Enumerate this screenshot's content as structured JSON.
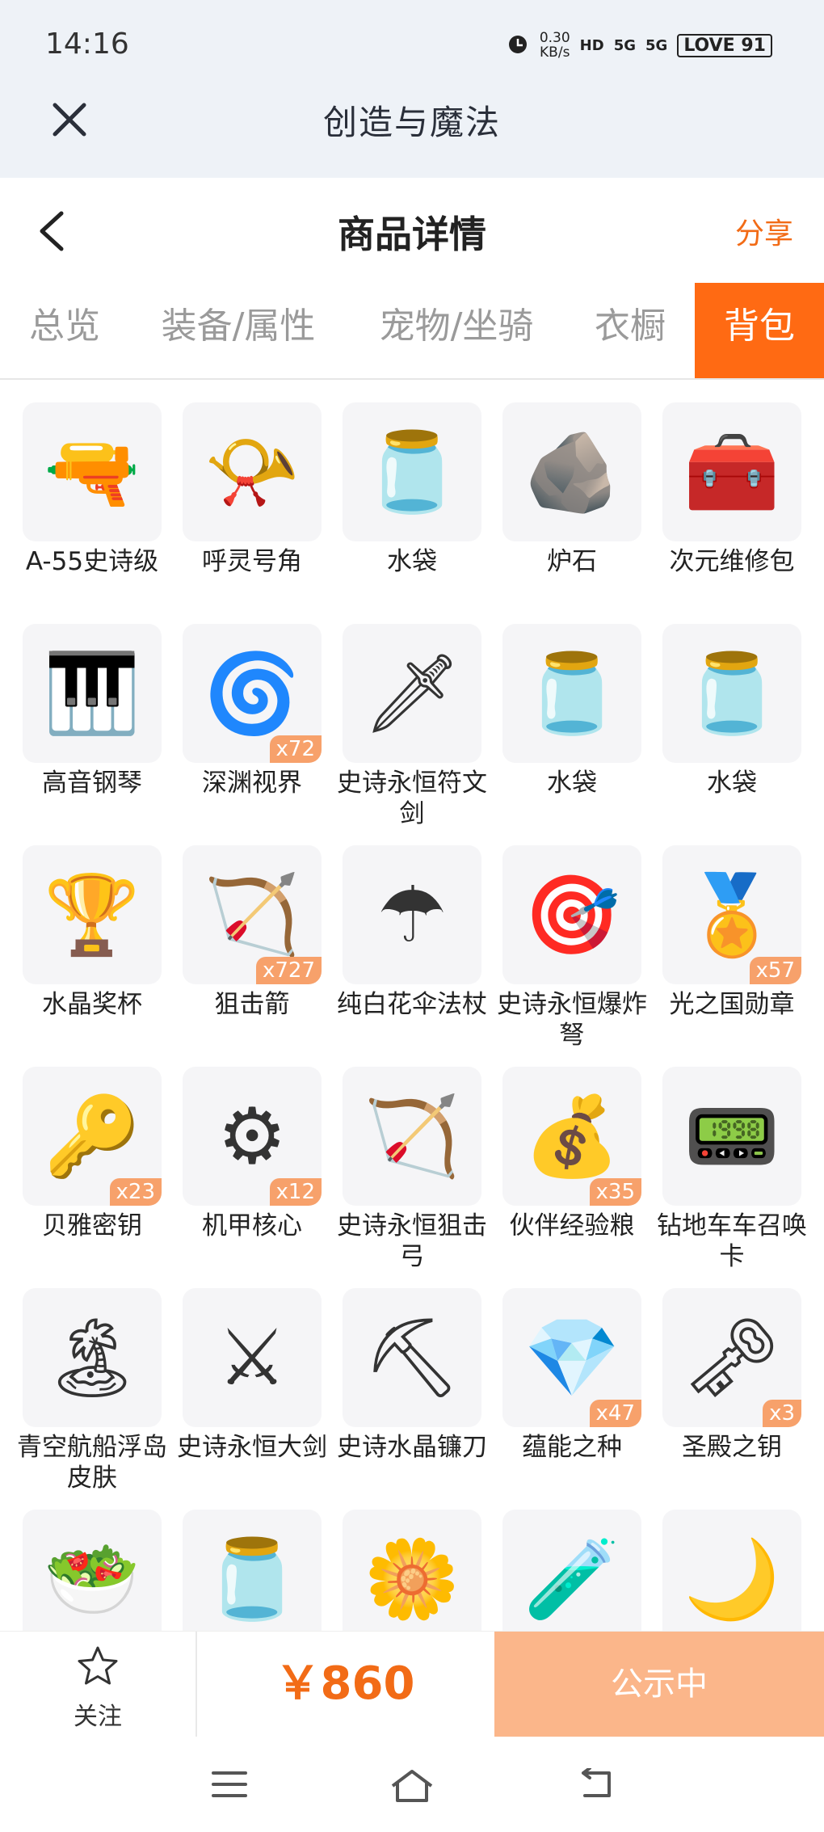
{
  "status": {
    "time": "14:16",
    "net_speed": "0.30",
    "net_unit": "KB/s",
    "hd": "HD",
    "sig1": "5G",
    "sig2": "5G",
    "battery": "LOVE 91"
  },
  "app": {
    "title": "创造与魔法"
  },
  "header": {
    "title": "商品详情",
    "share": "分享"
  },
  "tabs": [
    {
      "label": "总览"
    },
    {
      "label": "装备/属性"
    },
    {
      "label": "宠物/坐骑"
    },
    {
      "label": "衣橱"
    },
    {
      "label": "背包"
    }
  ],
  "items": [
    {
      "name": "A-55史诗级",
      "count": "",
      "icon": "rifle-icon",
      "glyph": "🔫"
    },
    {
      "name": "呼灵号角",
      "count": "",
      "icon": "horn-icon",
      "glyph": "📯"
    },
    {
      "name": "水袋",
      "count": "",
      "icon": "water-bag-icon",
      "glyph": "🫙"
    },
    {
      "name": "炉石",
      "count": "",
      "icon": "hearthstone-icon",
      "glyph": "🪨"
    },
    {
      "name": "次元维修包",
      "count": "",
      "icon": "repair-kit-icon",
      "glyph": "🧰"
    },
    {
      "name": "高音钢琴",
      "count": "",
      "icon": "piano-icon",
      "glyph": "🎹"
    },
    {
      "name": "深渊视界",
      "count": "x72",
      "icon": "abyss-eye-icon",
      "glyph": "🌀"
    },
    {
      "name": "史诗永恒符文剑",
      "count": "",
      "icon": "rune-sword-icon",
      "glyph": "🗡"
    },
    {
      "name": "水袋",
      "count": "",
      "icon": "water-bag-icon",
      "glyph": "🫙"
    },
    {
      "name": "水袋",
      "count": "",
      "icon": "water-bag-icon",
      "glyph": "🫙"
    },
    {
      "name": "水晶奖杯",
      "count": "",
      "icon": "crystal-trophy-icon",
      "glyph": "🏆"
    },
    {
      "name": "狙击箭",
      "count": "x727",
      "icon": "arrow-icon",
      "glyph": "🏹"
    },
    {
      "name": "纯白花伞法杖",
      "count": "",
      "icon": "umbrella-staff-icon",
      "glyph": "☂"
    },
    {
      "name": "史诗永恒爆炸弩",
      "count": "",
      "icon": "crossbow-icon",
      "glyph": "🎯"
    },
    {
      "name": "光之国勋章",
      "count": "x57",
      "icon": "medal-icon",
      "glyph": "🏅"
    },
    {
      "name": "贝雅密钥",
      "count": "x23",
      "icon": "keycard-icon",
      "glyph": "🔑"
    },
    {
      "name": "机甲核心",
      "count": "x12",
      "icon": "mech-core-icon",
      "glyph": "⚙"
    },
    {
      "name": "史诗永恒狙击弓",
      "count": "",
      "icon": "bow-icon",
      "glyph": "🏹"
    },
    {
      "name": "伙伴经验粮",
      "count": "x35",
      "icon": "food-bag-icon",
      "glyph": "💰"
    },
    {
      "name": "钻地车车召唤卡",
      "count": "",
      "icon": "summon-card-icon",
      "glyph": "📟"
    },
    {
      "name": "青空航船浮岛皮肤",
      "count": "",
      "icon": "island-skin-icon",
      "glyph": "🏝"
    },
    {
      "name": "史诗永恒大剑",
      "count": "",
      "icon": "greatsword-icon",
      "glyph": "⚔"
    },
    {
      "name": "史诗水晶镰刀",
      "count": "",
      "icon": "scythe-icon",
      "glyph": "⛏"
    },
    {
      "name": "蕴能之种",
      "count": "x47",
      "icon": "energy-seed-icon",
      "glyph": "💎"
    },
    {
      "name": "圣殿之钥",
      "count": "x3",
      "icon": "temple-key-icon",
      "glyph": "🗝"
    },
    {
      "name": "",
      "count": "",
      "icon": "food-plate-icon",
      "glyph": "🥗"
    },
    {
      "name": "",
      "count": "",
      "icon": "blue-jar-icon",
      "glyph": "🫙"
    },
    {
      "name": "",
      "count": "",
      "icon": "flower-icon",
      "glyph": "🌼"
    },
    {
      "name": "",
      "count": "",
      "icon": "green-jar-icon",
      "glyph": "🧪"
    },
    {
      "name": "",
      "count": "",
      "icon": "moon-icon",
      "glyph": "🌙"
    }
  ],
  "bottom": {
    "follow": "关注",
    "price": "￥860",
    "action": "公示中"
  },
  "colors": {
    "accent": "#ff6a13",
    "badge": "#f7a16b",
    "action_bg": "#fbb68a"
  }
}
